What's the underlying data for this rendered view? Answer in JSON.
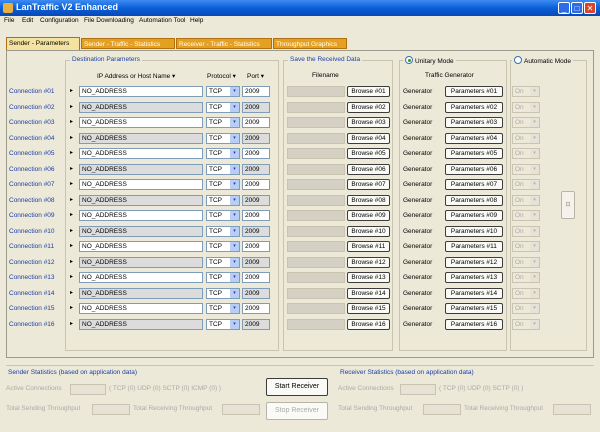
{
  "window": {
    "title": "LanTraffic V2 Enhanced",
    "min_label": "_",
    "max_label": "□",
    "close_label": "✕"
  },
  "menu": [
    "File",
    "Edit",
    "Configuration",
    "File Downloading",
    "Automation Tool",
    "Help"
  ],
  "tabs": [
    "Sender - Parameters",
    "Sender - Traffic - Statistics",
    "Receiver - Traffic - Statistics",
    "Throughput Graphics"
  ],
  "destination": {
    "title": "Destination Parameters",
    "ip_header": "IP Address or Host Name",
    "protocol_header": "Protocol",
    "port_header": "Port"
  },
  "save": {
    "title": "Save the Received Data",
    "filename_header": "Filename"
  },
  "mode": {
    "unitary": "Unitary Mode",
    "automatic": "Automatic Mode",
    "traffic_generator_header": "Traffic Generator"
  },
  "connections": [
    {
      "label": "Connection #01",
      "ip": "NO_ADDRESS",
      "protocol": "TCP",
      "port": "2009",
      "browse": "Browse #01",
      "gen": "Generator",
      "params": "Parameters #01",
      "auto": "On"
    },
    {
      "label": "Connection #02",
      "ip": "NO_ADDRESS",
      "protocol": "TCP",
      "port": "2009",
      "browse": "Browse #02",
      "gen": "Generator",
      "params": "Parameters #02",
      "auto": "On"
    },
    {
      "label": "Connection #03",
      "ip": "NO_ADDRESS",
      "protocol": "TCP",
      "port": "2009",
      "browse": "Browse #03",
      "gen": "Generator",
      "params": "Parameters #03",
      "auto": "On"
    },
    {
      "label": "Connection #04",
      "ip": "NO_ADDRESS",
      "protocol": "TCP",
      "port": "2009",
      "browse": "Browse #04",
      "gen": "Generator",
      "params": "Parameters #04",
      "auto": "On"
    },
    {
      "label": "Connection #05",
      "ip": "NO_ADDRESS",
      "protocol": "TCP",
      "port": "2009",
      "browse": "Browse #05",
      "gen": "Generator",
      "params": "Parameters #05",
      "auto": "On"
    },
    {
      "label": "Connection #06",
      "ip": "NO_ADDRESS",
      "protocol": "TCP",
      "port": "2009",
      "browse": "Browse #06",
      "gen": "Generator",
      "params": "Parameters #06",
      "auto": "On"
    },
    {
      "label": "Connection #07",
      "ip": "NO_ADDRESS",
      "protocol": "TCP",
      "port": "2009",
      "browse": "Browse #07",
      "gen": "Generator",
      "params": "Parameters #07",
      "auto": "On"
    },
    {
      "label": "Connection #08",
      "ip": "NO_ADDRESS",
      "protocol": "TCP",
      "port": "2009",
      "browse": "Browse #08",
      "gen": "Generator",
      "params": "Parameters #08",
      "auto": "On"
    },
    {
      "label": "Connection #09",
      "ip": "NO_ADDRESS",
      "protocol": "TCP",
      "port": "2009",
      "browse": "Browse #09",
      "gen": "Generator",
      "params": "Parameters #09",
      "auto": "On"
    },
    {
      "label": "Connection #10",
      "ip": "NO_ADDRESS",
      "protocol": "TCP",
      "port": "2009",
      "browse": "Browse #10",
      "gen": "Generator",
      "params": "Parameters #10",
      "auto": "On"
    },
    {
      "label": "Connection #11",
      "ip": "NO_ADDRESS",
      "protocol": "TCP",
      "port": "2009",
      "browse": "Browse #11",
      "gen": "Generator",
      "params": "Parameters #11",
      "auto": "On"
    },
    {
      "label": "Connection #12",
      "ip": "NO_ADDRESS",
      "protocol": "TCP",
      "port": "2009",
      "browse": "Browse #12",
      "gen": "Generator",
      "params": "Parameters #12",
      "auto": "On"
    },
    {
      "label": "Connection #13",
      "ip": "NO_ADDRESS",
      "protocol": "TCP",
      "port": "2009",
      "browse": "Browse #13",
      "gen": "Generator",
      "params": "Parameters #13",
      "auto": "On"
    },
    {
      "label": "Connection #14",
      "ip": "NO_ADDRESS",
      "protocol": "TCP",
      "port": "2009",
      "browse": "Browse #14",
      "gen": "Generator",
      "params": "Parameters #14",
      "auto": "On"
    },
    {
      "label": "Connection #15",
      "ip": "NO_ADDRESS",
      "protocol": "TCP",
      "port": "2009",
      "browse": "Browse #15",
      "gen": "Generator",
      "params": "Parameters #15",
      "auto": "On"
    },
    {
      "label": "Connection #16",
      "ip": "NO_ADDRESS",
      "protocol": "TCP",
      "port": "2009",
      "browse": "Browse #16",
      "gen": "Generator",
      "params": "Parameters #16",
      "auto": "On"
    }
  ],
  "sender_stats": {
    "title": "Sender Statistics (based on application data)",
    "active_connections": "Active Connections",
    "proto_counts": "( TCP (0) UDP (0) SCTP (0) ICMP (0) )",
    "total_sending": "Total Sending Throughput",
    "total_receiving": "Total Receiving Throughput"
  },
  "receiver_stats": {
    "title": "Receiver Statistics (based on application data)",
    "active_connections": "Active Connections",
    "proto_counts": "( TCP (0) UDP (0) SCTP (0) )",
    "total_sending": "Total Sending Throughput",
    "total_receiving": "Total Receiving Throughput"
  },
  "buttons": {
    "start_receiver": "Start Receiver",
    "stop_receiver": "Stop Receiver"
  },
  "glyphs": {
    "arrow": "▸",
    "dropdown": "▾",
    "side": "⊡"
  },
  "colors": {
    "title_blue": "#0a5fd8",
    "label_blue": "#1b3fa8",
    "tab_orange": "#e6a020",
    "tab_active": "#f4e3a0"
  }
}
